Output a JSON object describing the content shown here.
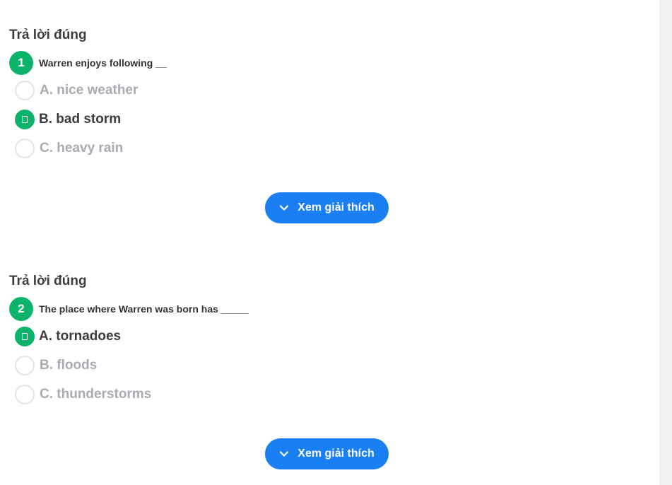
{
  "questions": [
    {
      "result_label": "Trả lời đúng",
      "number": "1",
      "text": "Warren enjoys following __",
      "options": [
        {
          "label": "A. nice weather",
          "selected": false
        },
        {
          "label": "B. bad storm",
          "selected": true
        },
        {
          "label": "C. heavy rain",
          "selected": false
        }
      ],
      "explain_button": "Xem giải thích"
    },
    {
      "result_label": "Trả lời đúng",
      "number": "2",
      "text": "The place where Warren was born has _____",
      "options": [
        {
          "label": "A. tornadoes",
          "selected": true
        },
        {
          "label": "B. floods",
          "selected": false
        },
        {
          "label": "C. thunderstorms",
          "selected": false
        }
      ],
      "explain_button": "Xem giải thích"
    }
  ],
  "icons": {
    "explain_icon": "chevron-down-icon",
    "selected_icon": "check-icon"
  },
  "colors": {
    "correct_green": "#0cb46b",
    "button_blue": "#1a7ff2",
    "muted_option": "#a9abb3",
    "dark_text": "#3c3c3c"
  }
}
